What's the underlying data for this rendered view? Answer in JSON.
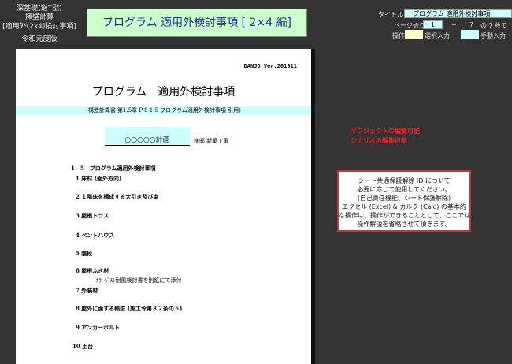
{
  "header": {
    "left_lines": [
      "深基礎(逆T型)",
      "擁壁計算",
      "[適用外(2x4)検討事項]",
      "令和元度版"
    ],
    "title": "プログラム 適用外検討事項 [ 2×4 編]"
  },
  "controls": {
    "title_label": "タイトル",
    "title_value": "プログラム 適用外検討事項",
    "page_label": "ページ始り",
    "page_start": "1",
    "tilde": "~",
    "page_end": "7",
    "page_suffix": "の 7 枚で",
    "op_label": "操作",
    "select_input": "選択入力",
    "manual_input": "手動入力",
    "colors": {
      "select": "#ffffcc",
      "manual": "#ccffff"
    }
  },
  "doc": {
    "version": "DANJO  Ver.201911",
    "title": "プログラム　適用外検討事項",
    "subtitle": "(構造計算書 第1.5章 P-8  1.5 プログラム適用外検討事項 引用)",
    "project": "○○○○○計画",
    "owner": "様邸  新築工事",
    "section": "1．5　プログラム適用外検討事項",
    "items": [
      "1 床材 (面外方向)",
      "2 １階床を構成する大引き及び束",
      "3 屋根トラス",
      "4 ペントハウス",
      "5 階段",
      "6 屋根ふき材",
      "7 外装材",
      "8 屋外に面する帳壁 (施工令第８２条の５)",
      "9 アンカーボルト",
      "10 土台"
    ],
    "note": "ｶﾗｰﾍﾞｽﾄ耐風検討書を別紙にて添付"
  },
  "side": {
    "red1": "オブジェクトの編集可能",
    "red2": "シナリオの編集可能",
    "notice": [
      "シート共通保護解除 ID について",
      "必要に応じて使用してください。",
      "(自己責任機能、シート保護解除)",
      "エクセル (Excel) & カルク (Calc) の基本的",
      "な操作は、操作ができることとして、ここでは",
      "操作解説を省略させて頂きます。"
    ]
  }
}
